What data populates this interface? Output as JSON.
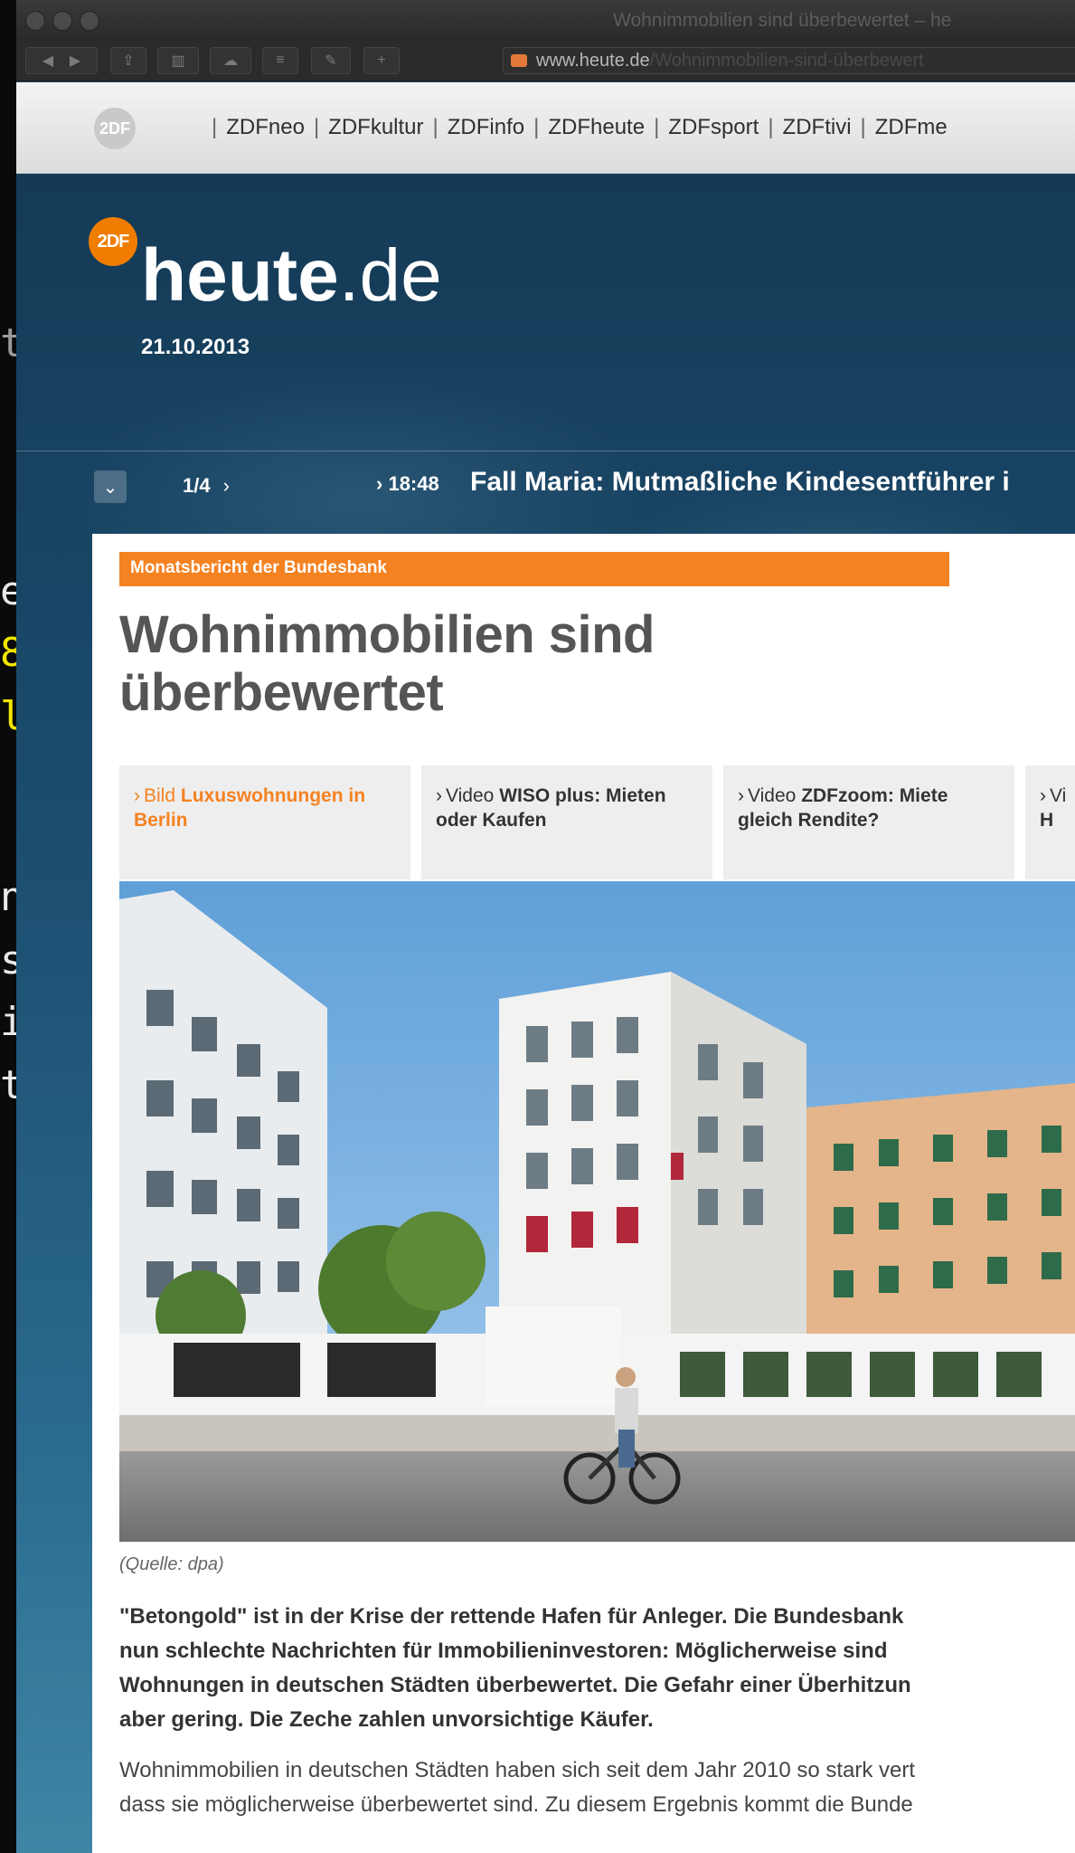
{
  "terminal": {
    "fragments": [
      {
        "text": "t",
        "color": "#9a9a9a"
      },
      {
        "text": "e",
        "color": "#e8e8e8"
      },
      {
        "text": "8",
        "color": "#f2e600"
      },
      {
        "text": "l",
        "color": "#f2e600"
      },
      {
        "text": "n",
        "color": "#e8e8e8"
      },
      {
        "text": "s",
        "color": "#e8e8e8"
      },
      {
        "text": "i",
        "color": "#e8e8e8"
      },
      {
        "text": "t",
        "color": "#e8e8e8"
      }
    ]
  },
  "browser": {
    "window_title": "Wohnimmobilien sind überbewertet – he",
    "url_host": "www.heute.de",
    "url_path": "/Wohnimmobilien-sind-überbewert"
  },
  "zdf_nav": {
    "logo": "2DF",
    "items": [
      "ZDFneo",
      "ZDFkultur",
      "ZDFinfo",
      "ZDFheute",
      "ZDFsport",
      "ZDFtivi",
      "ZDFme"
    ]
  },
  "site": {
    "logo_badge": "2DF",
    "logo_bold": "heute",
    "logo_suffix": ".de",
    "date": "21.10.2013"
  },
  "ticker": {
    "pager": "1/4",
    "time": "18:48",
    "headline": "Fall Maria: Mutmaßliche Kindesentführer i"
  },
  "article": {
    "kicker": "Monatsbericht der Bundesbank",
    "headline": "Wohnimmobilien sind überbewertet",
    "related": [
      {
        "type": "Bild",
        "title": "Luxuswohnungen in Berlin",
        "active": true
      },
      {
        "type": "Video",
        "title_bold": "WISO plus:",
        "title_rest": "Mieten oder Kaufen",
        "active": false
      },
      {
        "type": "Video",
        "title_bold": "ZDFzoom:",
        "title_rest": "Miete gleich Rendite?",
        "active": false
      },
      {
        "type": "Vi",
        "title_bold": "H",
        "title_rest": "",
        "active": false
      }
    ],
    "caption": "(Quelle: dpa)",
    "lead_lines": [
      "\"Betongold\" ist in der Krise der rettende Hafen für Anleger. Die Bundesbank",
      "nun schlechte Nachrichten für Immobilieninvestoren: Möglicherweise sind",
      "Wohnungen in deutschen Städten überbewertet. Die Gefahr einer Überhitzun",
      "aber gering. Die Zeche zahlen unvorsichtige Käufer."
    ],
    "body_lines": [
      "Wohnimmobilien in deutschen Städten haben sich seit dem Jahr 2010 so stark vert",
      "dass sie möglicherweise überbewertet sind. Zu diesem Ergebnis kommt die Bunde"
    ]
  }
}
